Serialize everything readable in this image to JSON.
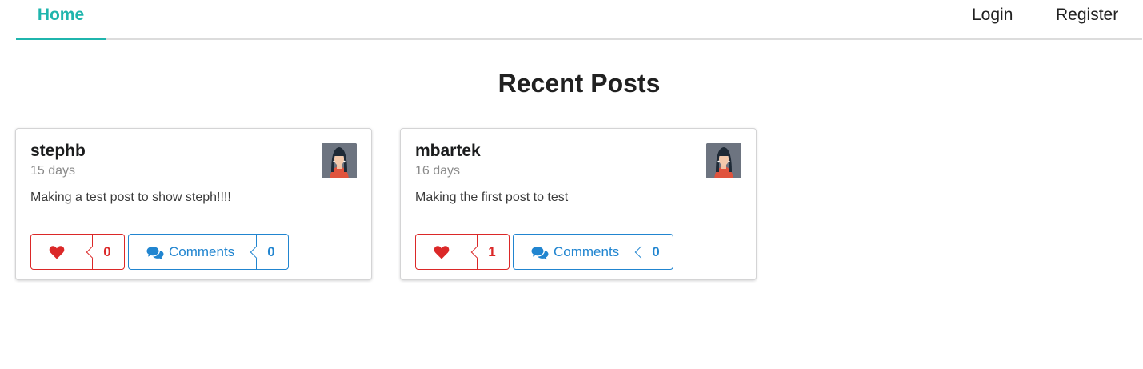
{
  "menu": {
    "home": "Home",
    "login": "Login",
    "register": "Register"
  },
  "page": {
    "title": "Recent Posts"
  },
  "posts": [
    {
      "author": "stephb",
      "age": "15 days",
      "body": "Making a test post to show steph!!!!",
      "like_count": "0",
      "comments_label": "Comments",
      "comment_count": "0"
    },
    {
      "author": "mbartek",
      "age": "16 days",
      "body": "Making the first post to test",
      "like_count": "1",
      "comments_label": "Comments",
      "comment_count": "0"
    }
  ],
  "colors": {
    "accent_teal": "#1fb5ad",
    "like_red": "#db2828",
    "comments_blue": "#2185d0"
  },
  "icons": {
    "like": "heart-icon",
    "comments": "comments-icon",
    "avatar": "avatar"
  }
}
